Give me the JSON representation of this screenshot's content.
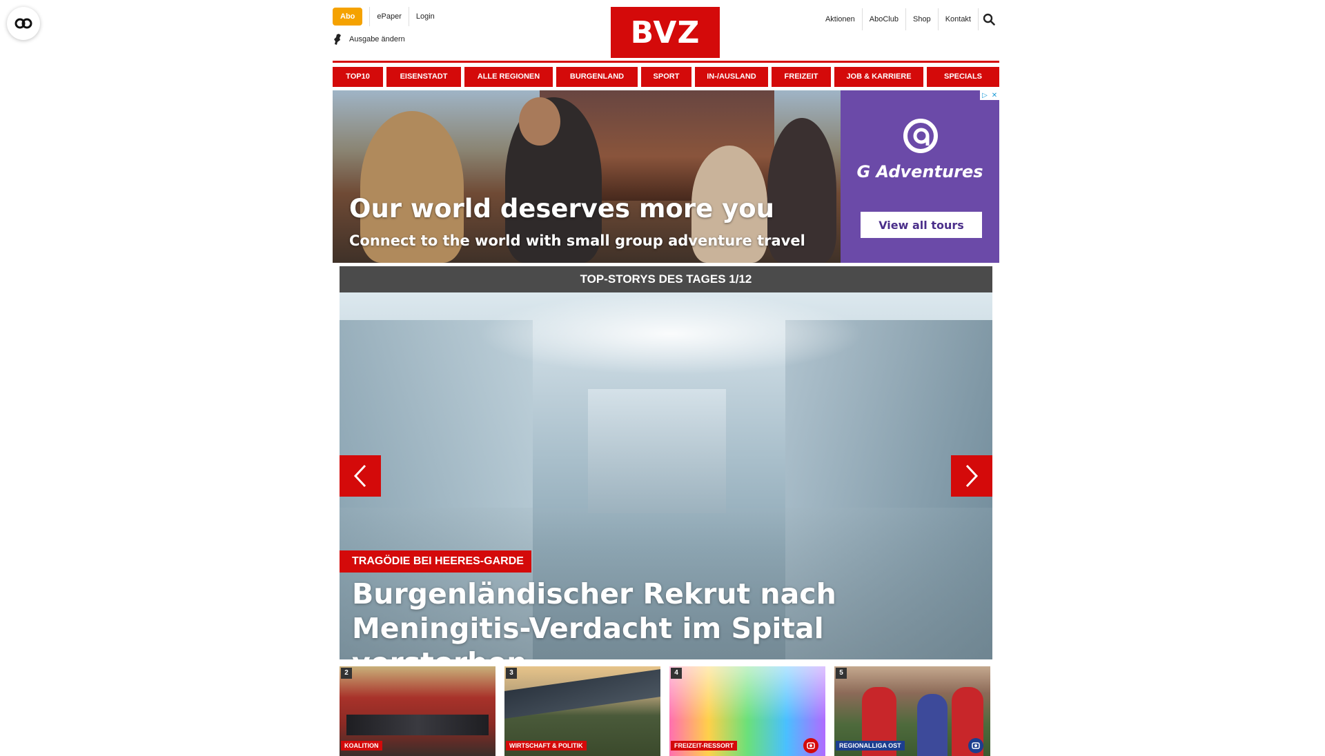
{
  "header": {
    "abo_label": "Abo",
    "epaper_label": "ePaper",
    "login_label": "Login",
    "edition_label": "Ausgabe ändern",
    "logo_text": "BVZ",
    "right_links": [
      "Aktionen",
      "AboClub",
      "Shop",
      "Kontakt"
    ]
  },
  "nav": {
    "items": [
      "TOP10",
      "EISENSTADT",
      "ALLE REGIONEN",
      "BURGENLAND",
      "SPORT",
      "IN-/AUSLAND",
      "FREIZEIT",
      "JOB & KARRIERE",
      "SPECIALS"
    ]
  },
  "ad": {
    "headline": "Our world deserves more you",
    "subline": "Connect to the world with small group adventure travel",
    "brand": "G Adventures",
    "cta": "View all tours"
  },
  "top_stories": {
    "bar_title": "TOP-STORYS DES TAGES 1/12",
    "hero": {
      "kicker": "TRAGÖDIE BEI HEERES-GARDE",
      "title": "Burgenländischer Rekrut nach Meningitis-Verdacht im Spital verstorben"
    },
    "thumbs": [
      {
        "number": "2",
        "tag": "KOALITION",
        "tag_color": "#d40a0a"
      },
      {
        "number": "3",
        "tag": "WIRTSCHAFT & POLITIK",
        "tag_color": "#d40a0a"
      },
      {
        "number": "4",
        "tag": "FREIZEIT-RESSORT",
        "tag_color": "#d40a0a",
        "badge": "gallery-icon"
      },
      {
        "number": "5",
        "tag": "REGIONALLIGA OST",
        "tag_color": "#1c3e8f",
        "badge": "gallery-icon"
      }
    ]
  },
  "colors": {
    "brand_red": "#d40a0a",
    "abo_orange": "#f5a200",
    "stories_bar": "#4b4b4b",
    "ad_purple": "#6b4aa8"
  }
}
